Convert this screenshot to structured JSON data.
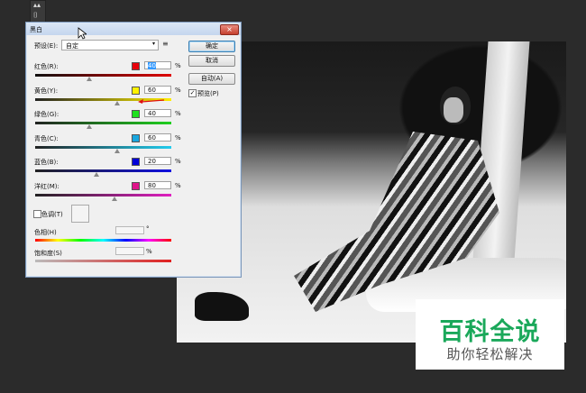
{
  "dialog": {
    "title": "黑白",
    "close_glyph": "×",
    "preset_label": "预设(E):",
    "preset_value": "自定",
    "preset_caret": "▾",
    "preset_menu_glyph": "≡",
    "buttons": {
      "ok": "确定",
      "cancel": "取消",
      "auto": "自动(A)"
    },
    "preview_label": "预览(P)",
    "preview_checked": true,
    "channels": [
      {
        "label": "红色(R):",
        "value": "40",
        "percent": "%",
        "color": "#e8000b",
        "slider_fraction": 0.4,
        "gradient": "linear-gradient(90deg,#111,#e00000)"
      },
      {
        "label": "黄色(Y):",
        "value": "60",
        "percent": "%",
        "color": "#fff200",
        "slider_fraction": 0.6,
        "gradient": "linear-gradient(90deg,#222,#ffee00)"
      },
      {
        "label": "绿色(G):",
        "value": "40",
        "percent": "%",
        "color": "#1fe11f",
        "slider_fraction": 0.4,
        "gradient": "linear-gradient(90deg,#222,#20d020)"
      },
      {
        "label": "青色(C):",
        "value": "60",
        "percent": "%",
        "color": "#19a7e0",
        "slider_fraction": 0.6,
        "gradient": "linear-gradient(90deg,#222,#22ccee)"
      },
      {
        "label": "蓝色(B):",
        "value": "20",
        "percent": "%",
        "color": "#0000d8",
        "slider_fraction": 0.45,
        "gradient": "linear-gradient(90deg,#222,#1010e0)"
      },
      {
        "label": "洋红(M):",
        "value": "80",
        "percent": "%",
        "color": "#e0148a",
        "slider_fraction": 0.58,
        "gradient": "linear-gradient(90deg,#222,#e020c0)"
      }
    ],
    "tint_label": "色调(T)",
    "tint_checked": false,
    "hue_label": "色相(H)",
    "hue_unit": "°",
    "saturation_label": "饱和度(S)",
    "saturation_unit": "%"
  },
  "watermark": {
    "line1": "百科全说",
    "line2": "助你轻松解决"
  }
}
